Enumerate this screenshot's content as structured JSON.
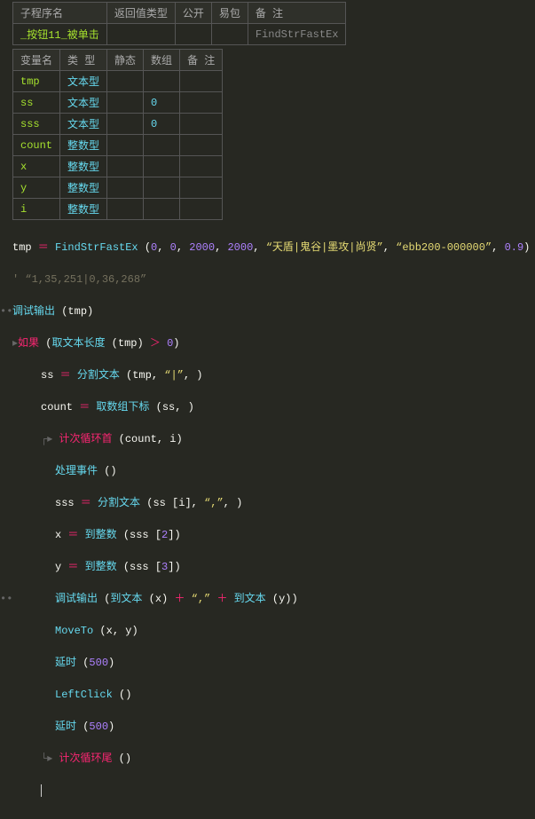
{
  "subTable": {
    "headers": [
      "子程序名",
      "返回值类型",
      "公开",
      "易包",
      "备 注"
    ],
    "row": [
      "_按钮11_被单击",
      "",
      "",
      "",
      "FindStrFastEx"
    ]
  },
  "varTable": {
    "headers": [
      "变量名",
      "类 型",
      "静态",
      "数组",
      "备 注"
    ],
    "rows": [
      [
        "tmp",
        "文本型",
        "",
        "",
        ""
      ],
      [
        "ss",
        "文本型",
        "",
        "0",
        ""
      ],
      [
        "sss",
        "文本型",
        "",
        "0",
        ""
      ],
      [
        "count",
        "整数型",
        "",
        "",
        ""
      ],
      [
        "x",
        "整数型",
        "",
        "",
        ""
      ],
      [
        "y",
        "整数型",
        "",
        "",
        ""
      ],
      [
        "i",
        "整数型",
        "",
        "",
        ""
      ]
    ]
  },
  "code": {
    "l1_var": "tmp",
    "l1_eq": " ＝ ",
    "l1_fn": "FindStrFastEx",
    "l1_open": " (",
    "l1_n1": "0",
    "l1_c": ", ",
    "l1_n2": "0",
    "l1_n3": "2000",
    "l1_n4": "2000",
    "l1_s1": "“天盾|鬼谷|墨攻|尚贤”",
    "l1_s2": "“ebb200-000000”",
    "l1_n5": "0.9",
    "l1_close": ")",
    "l2": "' “1,35,251|0,36,268”",
    "l3_fn": "调试输出",
    "l3_open": " (",
    "l3_arg": "tmp",
    "l3_close": ")",
    "l4_arrow": "▸",
    "l4_kw": "如果",
    "l4_open": " (",
    "l4_fn": "取文本长度",
    "l4_lp": " (",
    "l4_arg": "tmp",
    "l4_rp": ")",
    "l4_op": " ＞ ",
    "l4_n": "0",
    "l4_close": ")",
    "l5_var": "ss",
    "l5_eq": " ＝ ",
    "l5_fn": "分割文本",
    "l5_open": " (",
    "l5_a1": "tmp",
    "l5_c": ", ",
    "l5_s": "“|”",
    "l5_close": ", )",
    "l6_var": "count",
    "l6_eq": " ＝ ",
    "l6_fn": "取数组下标",
    "l6_open": " (",
    "l6_a": "ss",
    "l6_close": ", )",
    "l7_tree": "┌▸ ",
    "l7_kw": "计次循环首",
    "l7_open": " (",
    "l7_a1": "count",
    "l7_c": ", ",
    "l7_a2": "i",
    "l7_close": ")",
    "l8_fn": "处理事件",
    "l8_open": " ()",
    "l9_var": "sss",
    "l9_eq": " ＝ ",
    "l9_fn": "分割文本",
    "l9_open": " (",
    "l9_a1": "ss [i]",
    "l9_c": ", ",
    "l9_s": "“,”",
    "l9_close": ", )",
    "l10_var": "x",
    "l10_eq": " ＝ ",
    "l10_fn": "到整数",
    "l10_open": " (",
    "l10_a": "sss [",
    "l10_n": "2",
    "l10_close": "])",
    "l11_var": "y",
    "l11_eq": " ＝ ",
    "l11_fn": "到整数",
    "l11_open": " (",
    "l11_a": "sss [",
    "l11_n": "3",
    "l11_close": "])",
    "l12_fn": "调试输出",
    "l12_open": " (",
    "l12_fn2": "到文本",
    "l12_lp": " (",
    "l12_a1": "x",
    "l12_rp": ")",
    "l12_op": " ＋ ",
    "l12_s": "“,”",
    "l12_op2": " ＋ ",
    "l12_fn3": "到文本",
    "l12_lp2": " (",
    "l12_a2": "y",
    "l12_rp2": ")",
    "l12_close": ")",
    "l13_fn": "MoveTo",
    "l13_open": " (",
    "l13_a": "x, y",
    "l13_close": ")",
    "l14_fn": "延时",
    "l14_open": " (",
    "l14_n": "500",
    "l14_close": ")",
    "l15_fn": "LeftClick",
    "l15_open": " ()",
    "l16_fn": "延时",
    "l16_open": " (",
    "l16_n": "500",
    "l16_close": ")",
    "l17_tree": "└▸ ",
    "l17_kw": "计次循环尾",
    "l17_open": " ()",
    "l18": ""
  }
}
